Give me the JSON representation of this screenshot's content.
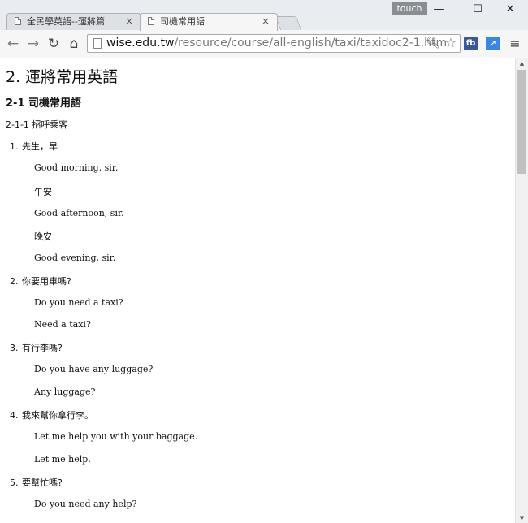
{
  "tabs": [
    {
      "title": "全民學英語--運將篇",
      "active": false
    },
    {
      "title": "司機常用語",
      "active": true
    }
  ],
  "window": {
    "touch_label": "touch",
    "minimize": "—",
    "maximize": "☐",
    "close": "✕"
  },
  "toolbar": {
    "back": "←",
    "forward": "→",
    "reload": "↻",
    "home": "⌂",
    "url_host": "wise.edu.tw",
    "url_path": "/resource/course/all-english/taxi/taxidoc2-1.htm",
    "zoom_icon": "search-icon",
    "star_icon": "star-icon",
    "ext_fb": "fb",
    "ext_blue": "↗",
    "menu": "≡"
  },
  "content": {
    "heading": "2. 運將常用英語",
    "section": "2-1 司機常用語",
    "subsection": "2-1-1 招呼乘客",
    "items": [
      {
        "num": "1.",
        "text": "先生，早",
        "answers": [
          {
            "text": "Good morning, sir.",
            "lang": "en"
          },
          {
            "text": "午安",
            "lang": "zh"
          },
          {
            "text": "Good afternoon, sir.",
            "lang": "en"
          },
          {
            "text": "晚安",
            "lang": "zh"
          },
          {
            "text": "Good evening, sir.",
            "lang": "en"
          }
        ]
      },
      {
        "num": "2.",
        "text": "你要用車嗎?",
        "answers": [
          {
            "text": "Do you need a taxi?",
            "lang": "en"
          },
          {
            "text": "Need a taxi?",
            "lang": "en"
          }
        ]
      },
      {
        "num": "3.",
        "text": "有行李嗎?",
        "answers": [
          {
            "text": "Do you have any luggage?",
            "lang": "en"
          },
          {
            "text": "Any luggage?",
            "lang": "en"
          }
        ]
      },
      {
        "num": "4.",
        "text": "我來幫你拿行李。",
        "answers": [
          {
            "text": "Let me help you with your baggage.",
            "lang": "en"
          },
          {
            "text": "Let me help.",
            "lang": "en"
          }
        ]
      },
      {
        "num": "5.",
        "text": "要幫忙嗎?",
        "answers": [
          {
            "text": "Do you need any help?",
            "lang": "en"
          }
        ]
      }
    ]
  }
}
